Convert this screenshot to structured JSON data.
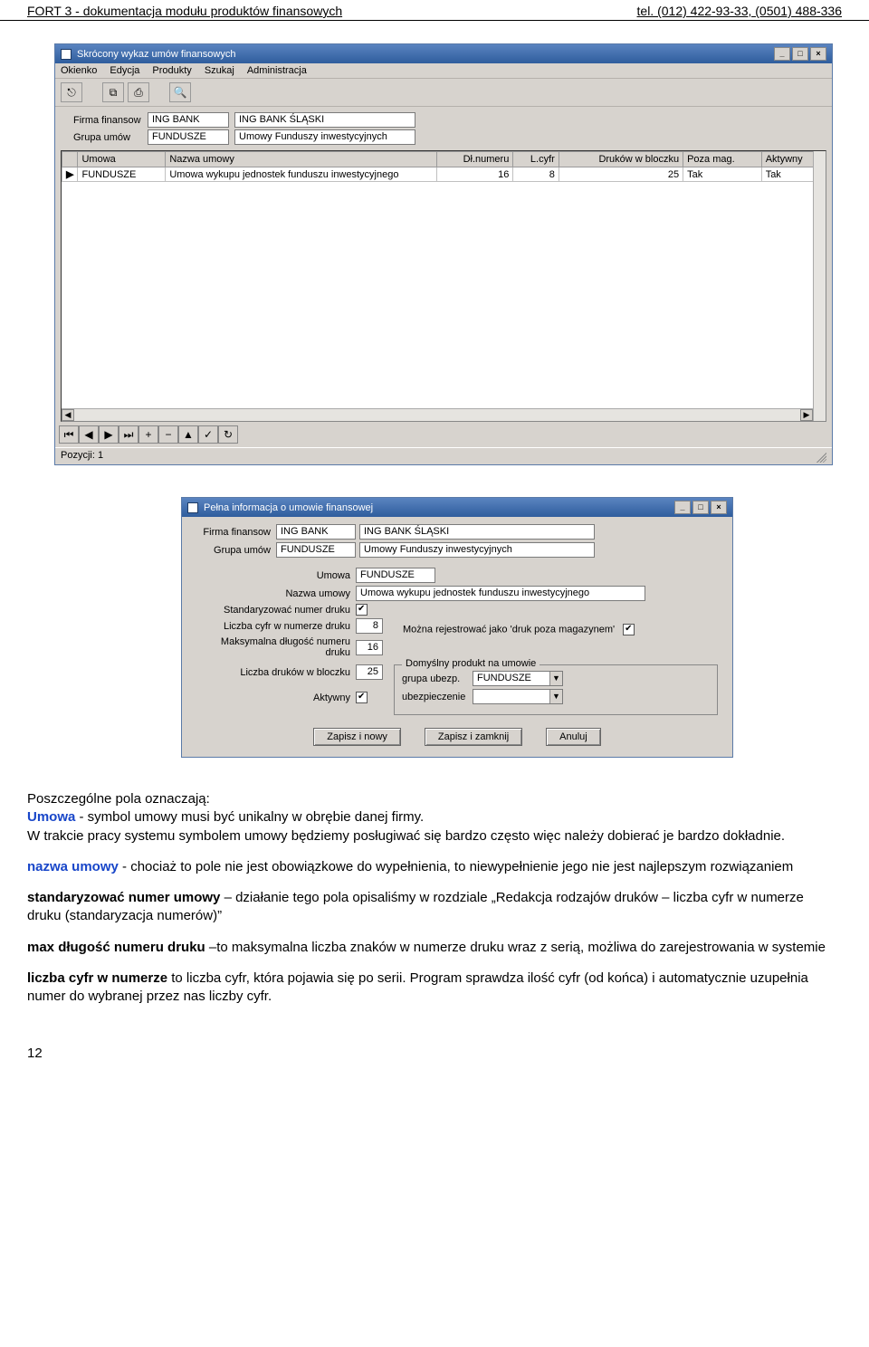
{
  "page_header": {
    "left": "FORT 3 - dokumentacja modułu produktów finansowych",
    "right": "tel. (012) 422-93-33, (0501) 488-336"
  },
  "window1": {
    "title": "Skrócony wykaz umów finansowych",
    "menu": [
      "Okienko",
      "Edycja",
      "Produkty",
      "Szukaj",
      "Administracja"
    ],
    "toolbar_icons": [
      "exit-icon",
      "copy-icon",
      "print-icon",
      "",
      "find-icon"
    ],
    "form": {
      "firma_label": "Firma finansow",
      "firma_code": "ING BANK",
      "firma_name": "ING BANK ŚLĄSKI",
      "grupa_label": "Grupa umów",
      "grupa_code": "FUNDUSZE",
      "grupa_name": "Umowy Funduszy inwestycyjnych"
    },
    "grid": {
      "headers": [
        "Umowa",
        "Nazwa umowy",
        "Dł.numeru",
        "L.cyfr",
        "Druków w bloczku",
        "Poza mag.",
        "Aktywny"
      ],
      "row": {
        "umowa": "FUNDUSZE",
        "nazwa": "Umowa wykupu jednostek funduszu inwestycyjnego",
        "dl": "16",
        "lc": "8",
        "druki": "25",
        "poza": "Tak",
        "akt": "Tak"
      }
    },
    "nav_icons": [
      "⏮",
      "◀",
      "▶",
      "⏭",
      "+",
      "−",
      "▲",
      "✓",
      "↻"
    ],
    "status": "Pozycji: 1"
  },
  "window2": {
    "title": "Pełna informacja o umowie finansowej",
    "firma_label": "Firma finansow",
    "firma_code": "ING BANK",
    "firma_name": "ING BANK ŚLĄSKI",
    "grupa_label": "Grupa umów",
    "grupa_code": "FUNDUSZE",
    "grupa_name": "Umowy Funduszy inwestycyjnych",
    "umowa_label": "Umowa",
    "umowa_val": "FUNDUSZE",
    "nazwa_label": "Nazwa umowy",
    "nazwa_val": "Umowa wykupu jednostek funduszu inwestycyjnego",
    "stand_label": "Standaryzować numer druku",
    "lcyfr_label": "Liczba cyfr w numerze druku",
    "lcyfr_val": "8",
    "maxdl_label": "Maksymalna długość numeru druku",
    "maxdl_val": "16",
    "rejestr_label": "Można rejestrować jako 'druk poza magazynem'",
    "bloczek_label": "Liczba druków w bloczku",
    "bloczek_val": "25",
    "aktywny_label": "Aktywny",
    "fieldset_legend": "Domyślny produkt na umowie",
    "fs_grupa_label": "grupa ubezp.",
    "fs_grupa_val": "FUNDUSZE",
    "fs_ubezp_label": "ubezpieczenie",
    "fs_ubezp_val": "",
    "btn_save_new": "Zapisz i nowy",
    "btn_save_close": "Zapisz i zamknij",
    "btn_cancel": "Anuluj"
  },
  "text": {
    "p1_lead": "Poszczególne pola oznaczają:",
    "p1_b": "Umowa",
    "p1_rest": " - symbol umowy musi być unikalny w obrębie danej firmy.",
    "p2": "W trakcie pracy systemu symbolem umowy będziemy posługiwać się bardzo często więc należy dobierać je bardzo dokładnie.",
    "p3_b": "nazwa umowy",
    "p3_rest": " - chociaż to pole nie jest obowiązkowe do wypełnienia, to niewypełnienie jego nie jest najlepszym rozwiązaniem",
    "p4_b": "standaryzować numer umowy",
    "p4_rest": " – działanie tego pola opisaliśmy w rozdziale „Redakcja rodzajów druków – liczba cyfr w numerze druku (standaryzacja numerów)”",
    "p5_b": "max długość numeru druku",
    "p5_rest": " –to maksymalna liczba znaków w numerze druku wraz z serią, możliwa do zarejestrowania w systemie",
    "p6_b": "liczba cyfr w numerze",
    "p6_rest": " to liczba cyfr, która pojawia się po serii. Program sprawdza ilość cyfr (od końca) i automatycznie uzupełnia numer do wybranej przez nas liczby cyfr."
  },
  "page_number": "12"
}
